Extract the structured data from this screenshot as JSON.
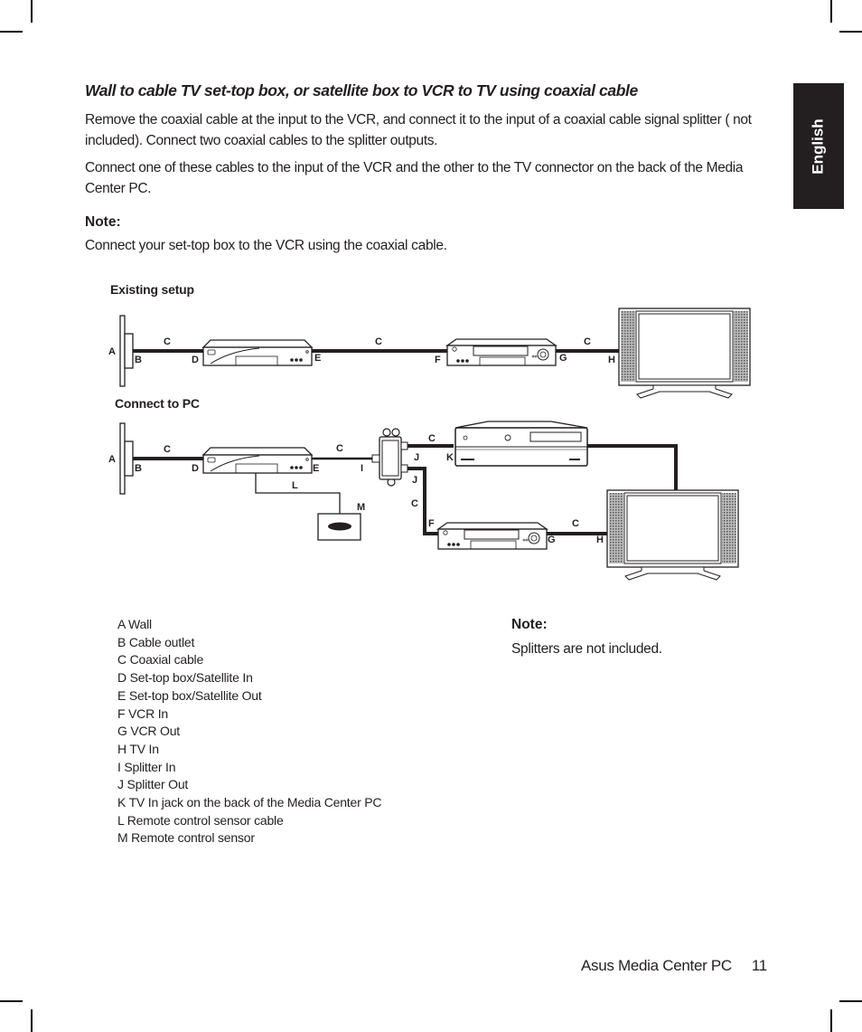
{
  "heading": "Wall to cable TV set-top box, or satellite box to VCR to TV  using coaxial cable",
  "paragraphs": [
    "Remove the coaxial cable at the input to the VCR, and connect it to the input of a coaxial cable signal splitter ( not included). Connect two coaxial cables to the splitter outputs.",
    "Connect one of these cables to the input of the VCR and the other to the TV connector on the back of the Media Center PC."
  ],
  "note1": {
    "label": "Note:",
    "text": "Connect your set-top box to the VCR using the coaxial cable."
  },
  "side_tab": "English",
  "diagram": {
    "existing_title": "Existing setup",
    "connect_title": "Connect to PC",
    "labels": {
      "A": "A",
      "B": "B",
      "C": "C",
      "D": "D",
      "E": "E",
      "F": "F",
      "G": "G",
      "H": "H",
      "I": "I",
      "J": "J",
      "K": "K",
      "L": "L",
      "M": "M"
    }
  },
  "legend": [
    "A  Wall",
    "B  Cable outlet",
    "C  Coaxial cable",
    "D  Set-top box/Satellite In",
    "E  Set-top box/Satellite Out",
    "F  VCR In",
    "G  VCR Out",
    "H  TV In",
    "I  Splitter In",
    "J  Splitter Out",
    "K  TV In jack on the back of the Media Center PC",
    "L  Remote control sensor cable",
    "M  Remote control sensor"
  ],
  "note2": {
    "label": "Note:",
    "text": "Splitters are not included."
  },
  "footer": {
    "title": "Asus Media Center PC",
    "page": "11"
  }
}
